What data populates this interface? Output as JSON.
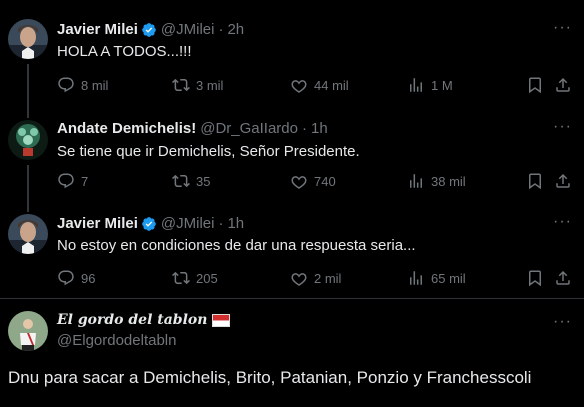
{
  "tweets": [
    {
      "name": "Javier Milei",
      "handle": "@JMilei",
      "sep": "·",
      "time": "2h",
      "text": "HOLA A TODOS...!!!",
      "replies": "8 mil",
      "reposts": "3 mil",
      "likes": "44 mil",
      "views": "1 M"
    },
    {
      "name": "Andate Demichelis!",
      "handle": "@Dr_GaIIardo",
      "sep": "·",
      "time": "1h",
      "text": "Se tiene que ir Demichelis,  Señor Presidente.",
      "replies": "7",
      "reposts": "35",
      "likes": "740",
      "views": "38 mil"
    },
    {
      "name": "Javier Milei",
      "handle": "@JMilei",
      "sep": "·",
      "time": "1h",
      "text": "No estoy en condiciones de dar una respuesta seria...",
      "replies": "96",
      "reposts": "205",
      "likes": "2 mil",
      "views": "65 mil"
    }
  ],
  "quote": {
    "name": "El gordo del tablon",
    "handle": "@Elgordodeltabln",
    "text": "Dnu para sacar a Demichelis, Brito, Patanian, Ponzio y Franchesscoli"
  },
  "more_label": "···",
  "colors": {
    "accent": "#1d9bf0",
    "muted": "#71767b",
    "text": "#e7e9ea",
    "bg": "#000000"
  }
}
